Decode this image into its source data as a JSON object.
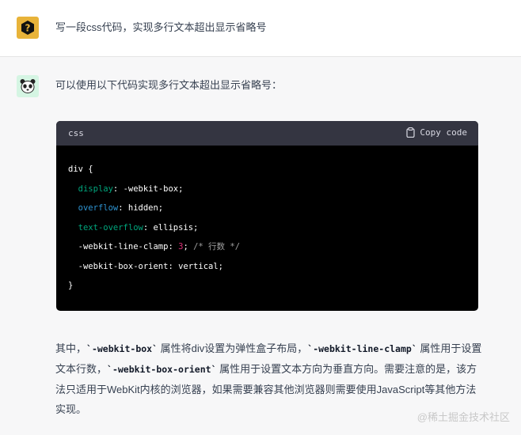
{
  "user_message": {
    "text": "写一段css代码，实现多行文本超出显示省略号"
  },
  "assistant_message": {
    "intro": "可以使用以下代码实现多行文本超出显示省略号：",
    "code_block": {
      "language": "css",
      "copy_label": "Copy code",
      "lines": {
        "l1": "div {",
        "l2_prop": "display",
        "l2_val": ": -webkit-box;",
        "l3_prop": "overflow",
        "l3_val": ": hidden;",
        "l4_prop": "text-overflow",
        "l4_val": ": ellipsis;",
        "l5_prop": "-webkit-line-clamp",
        "l5_colon": ": ",
        "l5_num": "3",
        "l5_semi": "; ",
        "l5_comment": "/* 行数 */",
        "l6": "-webkit-box-orient: vertical;",
        "l7": "}"
      }
    },
    "summary": {
      "p1": "其中，",
      "c1": "`-webkit-box`",
      "p2": " 属性将div设置为弹性盒子布局，",
      "c2": "`-webkit-line-clamp`",
      "p3": " 属性用于设置文本行数，",
      "c3": "`-webkit-box-orient`",
      "p4": " 属性用于设置文本方向为垂直方向。需要注意的是，该方法只适用于WebKit内核的浏览器，如果需要兼容其他浏览器则需要使用JavaScript等其他方法实现。"
    }
  },
  "watermark": "@稀土掘金技术社区",
  "colors": {
    "user_avatar": "#e8b339",
    "assistant_avatar": "#d5f5e3",
    "code_bg": "#000000",
    "code_header_bg": "#343541"
  },
  "icons": {
    "user_avatar": "question-mark-icon",
    "assistant_avatar": "panda-icon",
    "copy": "clipboard-icon"
  }
}
